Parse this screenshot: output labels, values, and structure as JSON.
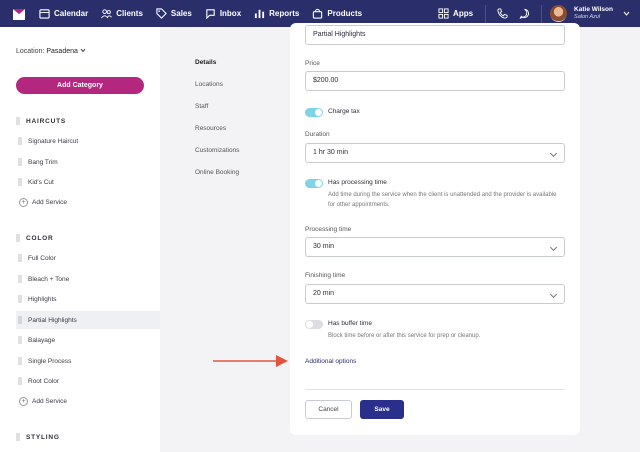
{
  "nav": {
    "items": [
      {
        "label": "Calendar",
        "icon": "calendar-icon"
      },
      {
        "label": "Clients",
        "icon": "clients-icon"
      },
      {
        "label": "Sales",
        "icon": "tag-icon"
      },
      {
        "label": "Inbox",
        "icon": "chat-icon"
      },
      {
        "label": "Reports",
        "icon": "bar-chart-icon"
      },
      {
        "label": "Products",
        "icon": "bag-icon"
      }
    ],
    "apps_label": "Apps",
    "user_name": "Katie Wilson",
    "user_business": "Salon Azul"
  },
  "sidebar": {
    "location_label": "Location:",
    "location_value": "Pasadena",
    "add_category": "Add Category",
    "groups": [
      {
        "title": "HAIRCUTS",
        "items": [
          "Signature Haircut",
          "Bang Trim",
          "Kid's Cut"
        ],
        "add": "Add Service"
      },
      {
        "title": "COLOR",
        "items": [
          "Full Color",
          "Bleach + Tone",
          "Highlights",
          "Partial Highlights",
          "Balayage",
          "Single Process",
          "Root Color"
        ],
        "add": "Add Service"
      },
      {
        "title": "STYLING"
      }
    ],
    "active_item": "Partial Highlights"
  },
  "details_nav": [
    "Details",
    "Locations",
    "Staff",
    "Resources",
    "Customizations",
    "Online Booking"
  ],
  "form": {
    "name_value": "Partial Highlights",
    "price_label": "Price",
    "price_value": "$200.00",
    "charge_tax": "Charge tax",
    "duration_label": "Duration",
    "duration_value": "1 hr 30 min",
    "processing_toggle": "Has processing time",
    "processing_help": "Add time during the service when the client is unattended and the provider is available for other appointments.",
    "processing_time_label": "Processing time",
    "processing_time_value": "30 min",
    "finishing_time_label": "Finishing time",
    "finishing_time_value": "20 min",
    "buffer_toggle": "Has buffer time",
    "buffer_help": "Block time before or after this service for prep or cleanup.",
    "additional_options": "Additional options",
    "cancel": "Cancel",
    "save": "Save"
  },
  "colors": {
    "nav_bg": "#2a2f6b",
    "accent": "#b3277f",
    "save": "#2a2f8c",
    "toggle_on": "#7ed3e6",
    "arrow": "#e2543b"
  }
}
